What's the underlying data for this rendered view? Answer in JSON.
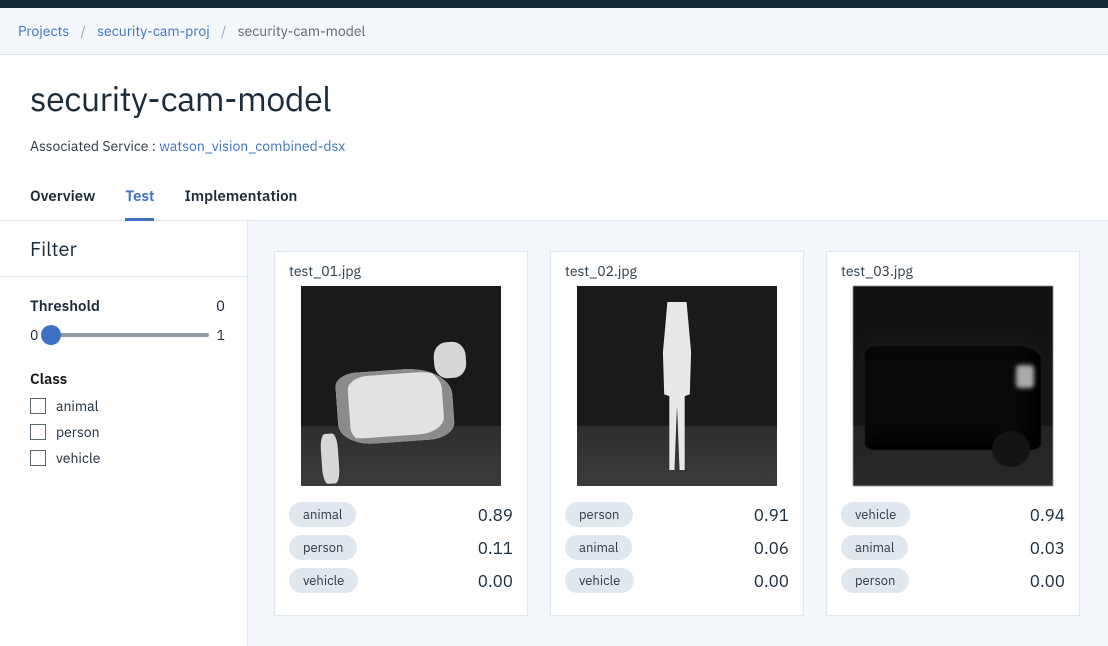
{
  "breadcrumb": {
    "root": "Projects",
    "project": "security-cam-proj",
    "current": "security-cam-model"
  },
  "header": {
    "title": "security-cam-model",
    "assoc_label": "Associated Service : ",
    "assoc_link": "watson_vision_combined-dsx"
  },
  "tabs": {
    "overview": "Overview",
    "test": "Test",
    "implementation": "Implementation",
    "active": "test"
  },
  "filter": {
    "heading": "Filter",
    "threshold_label": "Threshold",
    "threshold_value": "0",
    "slider_min": "0",
    "slider_max": "1",
    "class_label": "Class",
    "classes": [
      "animal",
      "person",
      "vehicle"
    ]
  },
  "results": [
    {
      "filename": "test_01.jpg",
      "thumb_kind": "dog",
      "scores": [
        {
          "label": "animal",
          "value": "0.89"
        },
        {
          "label": "person",
          "value": "0.11"
        },
        {
          "label": "vehicle",
          "value": "0.00"
        }
      ]
    },
    {
      "filename": "test_02.jpg",
      "thumb_kind": "person",
      "scores": [
        {
          "label": "person",
          "value": "0.91"
        },
        {
          "label": "animal",
          "value": "0.06"
        },
        {
          "label": "vehicle",
          "value": "0.00"
        }
      ]
    },
    {
      "filename": "test_03.jpg",
      "thumb_kind": "vehicle",
      "scores": [
        {
          "label": "vehicle",
          "value": "0.94"
        },
        {
          "label": "animal",
          "value": "0.03"
        },
        {
          "label": "person",
          "value": "0.00"
        }
      ]
    }
  ]
}
